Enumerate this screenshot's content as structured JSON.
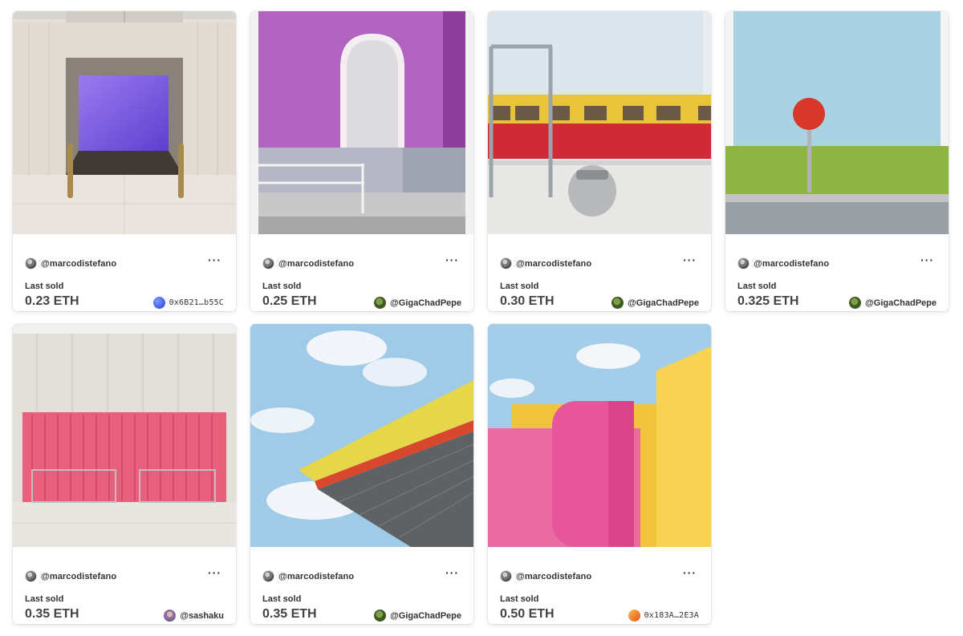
{
  "cards": [
    {
      "creator": "@marcodistefano",
      "more": "···",
      "label": "Last sold",
      "price": "0.23 ETH",
      "owner": "0x6B21…b55C",
      "owner_avatar": "blue-gradient",
      "art": "purple-doorway-with-bollards"
    },
    {
      "creator": "@marcodistefano",
      "more": "···",
      "label": "Last sold",
      "price": "0.25 ETH",
      "owner": "@GigaChadPepe",
      "owner_avatar": "pepe",
      "art": "purple-wall-arched-door"
    },
    {
      "creator": "@marcodistefano",
      "more": "···",
      "label": "Last sold",
      "price": "0.30 ETH",
      "owner": "@GigaChadPepe",
      "owner_avatar": "pepe",
      "art": "red-yellow-train-and-bin"
    },
    {
      "creator": "@marcodistefano",
      "more": "···",
      "label": "Last sold",
      "price": "0.325 ETH",
      "owner": "@GigaChadPepe",
      "owner_avatar": "pepe",
      "art": "red-sign-on-green-field"
    },
    {
      "creator": "@marcodistefano",
      "more": "···",
      "label": "Last sold",
      "price": "0.35 ETH",
      "owner": "@sashaku",
      "owner_avatar": "sashaku",
      "art": "pink-shipping-container"
    },
    {
      "creator": "@marcodistefano",
      "more": "···",
      "label": "Last sold",
      "price": "0.35 ETH",
      "owner": "@GigaChadPepe",
      "owner_avatar": "pepe",
      "art": "yellow-red-canopy-sky"
    },
    {
      "creator": "@marcodistefano",
      "more": "···",
      "label": "Last sold",
      "price": "0.50 ETH",
      "owner": "0x183A…2E3A",
      "owner_avatar": "orange-gradient",
      "art": "pink-yellow-building"
    }
  ],
  "colors": {
    "card_bg": "#ffffff",
    "text": "#333333",
    "price": "#444444"
  }
}
